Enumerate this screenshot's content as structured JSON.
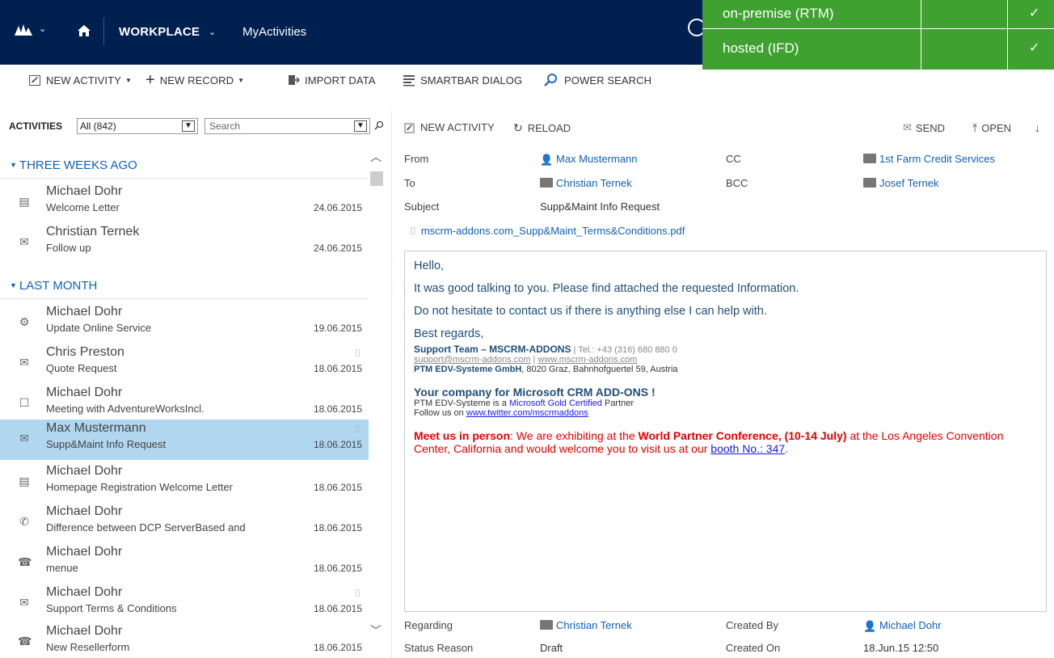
{
  "topnav": {
    "workplace": "WORKPLACE",
    "area": "MyActivities"
  },
  "overlay": {
    "rows": [
      {
        "label": "on-premise (RTM)",
        "check": "✓"
      },
      {
        "label": "hosted (IFD)",
        "check": "✓"
      }
    ]
  },
  "commandbar": {
    "new_activity": "NEW ACTIVITY",
    "new_record": "NEW RECORD",
    "import_data": "IMPORT DATA",
    "smartbar_dialog": "SMARTBAR DIALOG",
    "power_search": "POWER SEARCH"
  },
  "list": {
    "header": "ACTIVITIES",
    "view": "All (842)",
    "search_placeholder": "Search",
    "groups": [
      {
        "label": "THREE WEEKS AGO"
      },
      {
        "label": "LAST MONTH"
      }
    ],
    "items": [
      {
        "name": "Michael Dohr",
        "sub": "Welcome Letter",
        "date": "24.06.2015",
        "icon": "letter-icon"
      },
      {
        "name": "Christian Ternek",
        "sub": "Follow up",
        "date": "24.06.2015",
        "icon": "email-icon"
      },
      {
        "name": "Michael Dohr",
        "sub": "Update Online Service",
        "date": "19.06.2015",
        "icon": "service-icon"
      },
      {
        "name": "Chris Preston",
        "sub": "Quote Request",
        "date": "18.06.2015",
        "icon": "email-icon",
        "clip": "paperclip-icon"
      },
      {
        "name": "Michael Dohr",
        "sub": "Meeting with AdventureWorksIncl.",
        "date": "18.06.2015",
        "icon": "appointment-icon"
      },
      {
        "name": "Max Mustermann",
        "sub": "Supp&Maint Info Request",
        "date": "18.06.2015",
        "icon": "email-icon",
        "clip": "paperclip-icon",
        "selected": true
      },
      {
        "name": "Michael Dohr",
        "sub": "Homepage Registration Welcome Letter",
        "date": "18.06.2015",
        "icon": "letter-icon"
      },
      {
        "name": "Michael Dohr",
        "sub": "Difference between DCP ServerBased and",
        "date": "18.06.2015",
        "icon": "phone-icon"
      },
      {
        "name": "Michael Dohr",
        "sub": "menue",
        "date": "18.06.2015",
        "icon": "fax-icon"
      },
      {
        "name": "Michael Dohr",
        "sub": "Support Terms & Conditions",
        "date": "18.06.2015",
        "icon": "email-icon",
        "clip": "paperclip-icon"
      },
      {
        "name": "Michael Dohr",
        "sub": "New Resellerform",
        "date": "18.06.2015",
        "icon": "fax-icon"
      }
    ]
  },
  "detail": {
    "commands": {
      "new_activity": "NEW ACTIVITY",
      "reload": "RELOAD",
      "send": "SEND",
      "open": "OPEN"
    },
    "fields": {
      "from_label": "From",
      "from_value": "Max Mustermann",
      "to_label": "To",
      "to_value": "Christian Ternek",
      "subject_label": "Subject",
      "subject_value": "Supp&Maint Info Request",
      "cc_label": "CC",
      "cc_value": "1st Farm Credit Services",
      "bcc_label": "BCC",
      "bcc_value": "Josef Ternek"
    },
    "attachment": "mscrm-addons.com_Supp&Maint_Terms&Conditions.pdf",
    "email": {
      "greeting": "Hello,",
      "line1": "It was good talking to you. Please find attached the requested Information.",
      "line2": "Do not hesitate to contact us if there is anything else I can help with.",
      "regards": "Best regards,",
      "sig_team": "Support Team – MSCRM-ADDONS",
      "sig_tel": " | Tel.: +43 (316) 680 880 0",
      "sig_mail": "support@mscrm-addons.com",
      "sig_sep": " | ",
      "sig_web": "www.mscrm-addons.com",
      "sig_company": "PTM EDV-Systeme GmbH",
      "sig_address": ", 8020 Graz, Bahnhofguertel 59, Austria",
      "company_tag": "Your company for Microsoft CRM ADD-ONS !",
      "gold_pre": "PTM EDV-Systeme is a ",
      "gold_link": "Microsoft Gold Certified",
      "gold_post": " Partner",
      "follow_pre": "Follow us on ",
      "follow_link": "www.twitter.com/mscrmaddons",
      "meet_bold": "Meet us in person",
      "meet_text1": ": We are exhibiting at the ",
      "meet_bold2": "World Partner Conference, (10-14 July)",
      "meet_text2": " at the Los Angeles Convention Center, California and would welcome you to visit us at our ",
      "meet_link": "booth No.: 347",
      "meet_end": "."
    },
    "bottom": {
      "regarding_label": "Regarding",
      "regarding_value": "Christian Ternek",
      "status_label": "Status Reason",
      "status_value": "Draft",
      "createdby_label": "Created By",
      "createdby_value": "Michael Dohr",
      "createdon_label": "Created On",
      "createdon_value": "18.Jun.15 12:50"
    }
  }
}
